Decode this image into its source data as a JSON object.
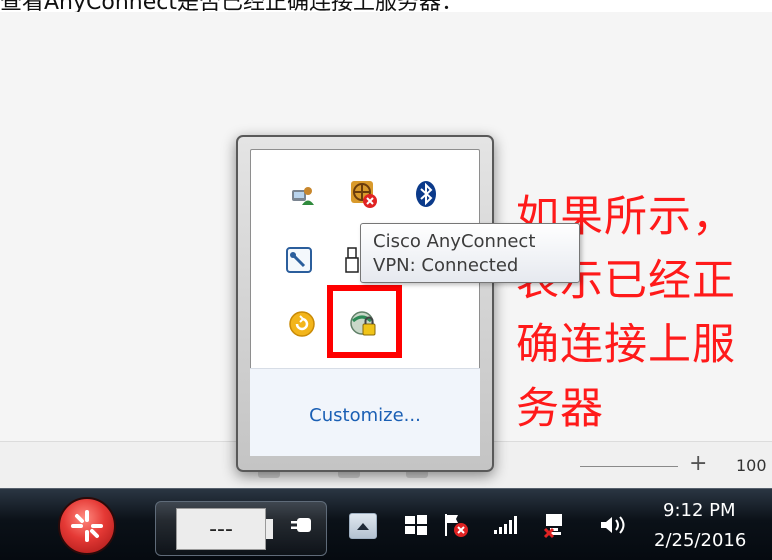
{
  "caption": "查看AnyConnect是否已经正确连接上服务器：",
  "annotation": {
    "lines": [
      "如果所示，",
      "表示已经正",
      "确连接上服",
      "务器"
    ]
  },
  "status_bar": {
    "zoom_percent": "100"
  },
  "tray_popup": {
    "icons": [
      "network-user-icon",
      "network-error-icon",
      "bluetooth-icon",
      "tool-settings-icon",
      "usb-device-icon",
      "update-icon",
      "cisco-anyconnect-vpn-icon"
    ],
    "tooltip": {
      "line1": "Cisco AnyConnect",
      "line2": "VPN: Connected"
    },
    "customize_label": "Customize..."
  },
  "taskbar": {
    "battery_label": "---",
    "clock": {
      "time": "9:12 PM",
      "date": "2/25/2016"
    },
    "tray_icons": [
      "power-plug-icon",
      "show-hidden-icons-icon",
      "windows-flag-icon",
      "action-center-icon",
      "signal-bars-icon",
      "network-disconnected-icon",
      "volume-icon"
    ]
  },
  "colors": {
    "annotation_red": "#ff1a1a",
    "highlight_red": "#ff0000",
    "link_blue": "#1a5fb4",
    "start_orb_red": "#e53935"
  }
}
